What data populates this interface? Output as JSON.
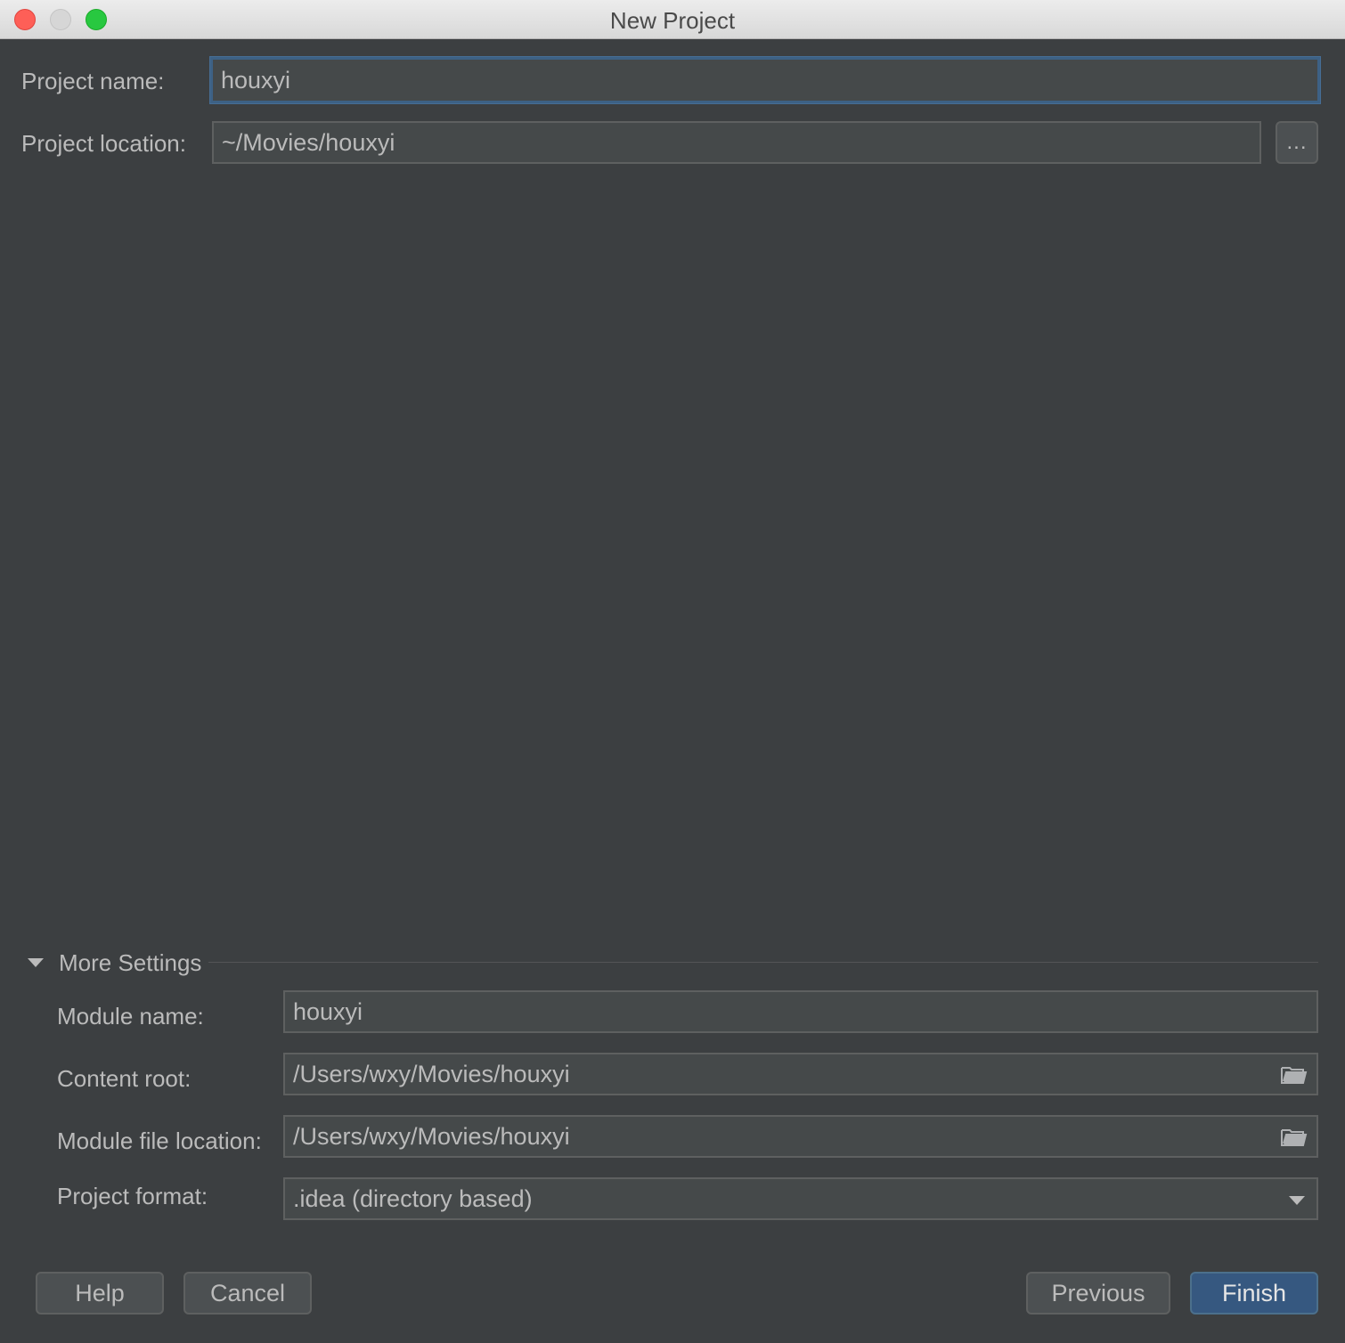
{
  "window": {
    "title": "New Project"
  },
  "project_name": {
    "label": "Project name:",
    "value": "houxyi"
  },
  "project_location": {
    "label": "Project location:",
    "value": "~/Movies/houxyi",
    "browse_label": "..."
  },
  "more_settings": {
    "title": "More Settings",
    "module_name": {
      "label": "Module name:",
      "value": "houxyi"
    },
    "content_root": {
      "label": "Content root:",
      "value": "/Users/wxy/Movies/houxyi"
    },
    "module_file_location": {
      "label": "Module file location:",
      "value": "/Users/wxy/Movies/houxyi"
    },
    "project_format": {
      "label": "Project format:",
      "value": ".idea (directory based)"
    }
  },
  "buttons": {
    "help": "Help",
    "cancel": "Cancel",
    "previous": "Previous",
    "finish": "Finish"
  },
  "colors": {
    "background": "#3c3f41",
    "field": "#45494a",
    "focus": "#3d6185",
    "primary_button": "#365880"
  }
}
